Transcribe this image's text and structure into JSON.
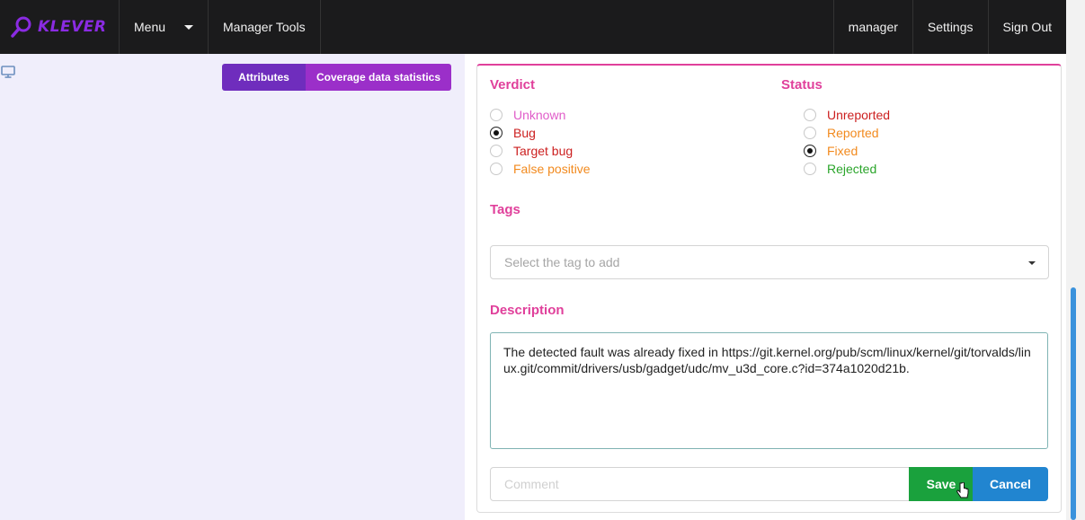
{
  "header": {
    "logo_text": "KLEVER",
    "menu_label": "Menu",
    "manager_tools_label": "Manager Tools",
    "user_label": "manager",
    "settings_label": "Settings",
    "signout_label": "Sign Out"
  },
  "left": {
    "tabs": [
      {
        "label": "Attributes"
      },
      {
        "label": "Coverage data statistics"
      }
    ]
  },
  "verdict": {
    "title": "Verdict",
    "options": [
      {
        "label": "Unknown",
        "checked": false,
        "color": "#e05cc9"
      },
      {
        "label": "Bug",
        "checked": true,
        "color": "#cc1f1f"
      },
      {
        "label": "Target bug",
        "checked": false,
        "color": "#cc1f1f"
      },
      {
        "label": "False positive",
        "checked": false,
        "color": "#f28a1e"
      }
    ]
  },
  "status": {
    "title": "Status",
    "options": [
      {
        "label": "Unreported",
        "checked": false,
        "color": "#cc1f1f"
      },
      {
        "label": "Reported",
        "checked": false,
        "color": "#f28a1e"
      },
      {
        "label": "Fixed",
        "checked": true,
        "color": "#f28a1e"
      },
      {
        "label": "Rejected",
        "checked": false,
        "color": "#2aa52a"
      }
    ]
  },
  "tags": {
    "title": "Tags",
    "placeholder": "Select the tag to add"
  },
  "description": {
    "title": "Description",
    "text": "The detected fault was already fixed in https://git.kernel.org/pub/scm/linux/kernel/git/torvalds/linux.git/commit/drivers/usb/gadget/udc/mv_u3d_core.c?id=374a1020d21b."
  },
  "footer": {
    "comment_placeholder": "Comment",
    "save_label": "Save",
    "cancel_label": "Cancel"
  },
  "colors": {
    "accent": "#e0409b",
    "topbar": "#1b1b1c",
    "save": "#1aa13d",
    "cancel": "#2185d0"
  }
}
